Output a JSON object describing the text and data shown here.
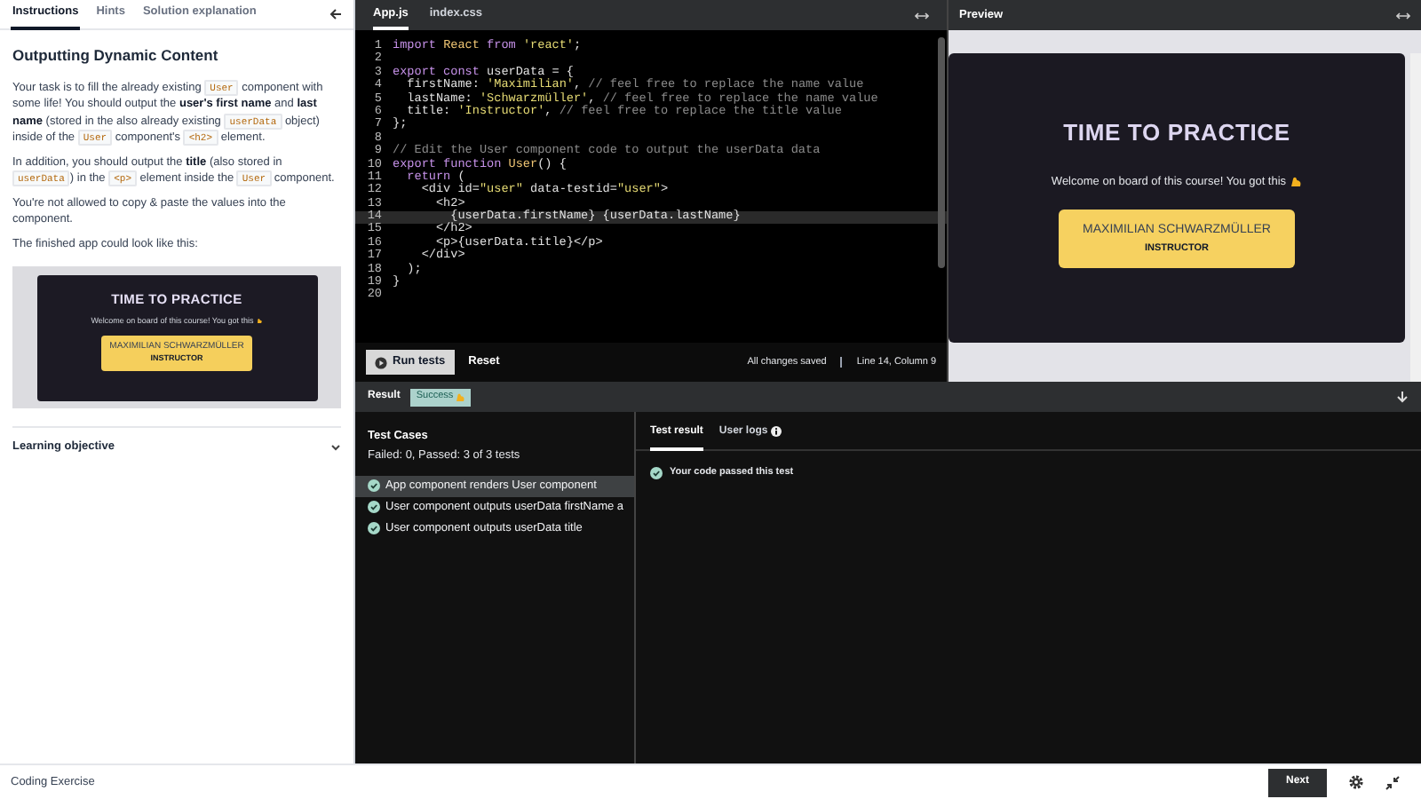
{
  "instructions": {
    "tabs": [
      {
        "label": "Instructions",
        "selected": true
      },
      {
        "label": "Hints",
        "selected": false
      },
      {
        "label": "Solution explanation",
        "selected": false
      }
    ],
    "heading": "Outputting Dynamic Content",
    "paragraphs": [
      [
        {
          "kind": "text",
          "text": "Your task is to fill the already existing "
        },
        {
          "kind": "code",
          "text": "User"
        },
        {
          "kind": "text",
          "text": " component with some life! You should output the "
        },
        {
          "kind": "bold",
          "text": "user's first name"
        },
        {
          "kind": "text",
          "text": " and "
        },
        {
          "kind": "bold",
          "text": "last name"
        },
        {
          "kind": "text",
          "text": " (stored in the also already existing "
        },
        {
          "kind": "code",
          "text": "userData"
        },
        {
          "kind": "text",
          "text": " object) inside of the "
        },
        {
          "kind": "code",
          "text": "User"
        },
        {
          "kind": "text",
          "text": " component's "
        },
        {
          "kind": "code",
          "text": "<h2>"
        },
        {
          "kind": "text",
          "text": " element."
        }
      ],
      [
        {
          "kind": "text",
          "text": "In addition, you should output the "
        },
        {
          "kind": "bold",
          "text": "title"
        },
        {
          "kind": "text",
          "text": " (also stored in "
        },
        {
          "kind": "code",
          "text": "userData"
        },
        {
          "kind": "text",
          "text": ") in the "
        },
        {
          "kind": "code",
          "text": "<p>"
        },
        {
          "kind": "text",
          "text": " element inside the "
        },
        {
          "kind": "code",
          "text": "User"
        },
        {
          "kind": "text",
          "text": " component."
        }
      ],
      [
        {
          "kind": "text",
          "text": "You're not allowed to copy & paste the values into the component."
        }
      ],
      [
        {
          "kind": "text",
          "text": "The finished app could look like this:"
        }
      ]
    ],
    "example": {
      "title": "TIME TO PRACTICE",
      "welcome": "Welcome on board of this course! You got this",
      "name": "MAXIMILIAN SCHWARZMÜLLER",
      "role": "INSTRUCTOR"
    },
    "learning_objective": {
      "label": "Learning objective",
      "expanded": false
    }
  },
  "editor": {
    "tabs": [
      {
        "label": "App.js",
        "selected": true
      },
      {
        "label": "index.css",
        "selected": false
      }
    ],
    "lines": [
      {
        "number": "1",
        "current": false,
        "tokens": [
          {
            "kind": "kw",
            "text": "import "
          },
          {
            "kind": "name",
            "text": "React "
          },
          {
            "kind": "kw",
            "text": "from "
          },
          {
            "kind": "str",
            "text": "'react'"
          },
          {
            "kind": "plain",
            "text": ";"
          }
        ]
      },
      {
        "number": "2",
        "current": false
      },
      {
        "number": "3",
        "current": false,
        "tokens": [
          {
            "kind": "kw",
            "text": "export const"
          },
          {
            "kind": "plain",
            "text": " userData = {"
          }
        ]
      },
      {
        "number": "4",
        "current": false,
        "tokens": [
          {
            "kind": "plain",
            "text": "  firstName: "
          },
          {
            "kind": "str",
            "text": "'Maximilian'"
          },
          {
            "kind": "plain",
            "text": ", "
          },
          {
            "kind": "com",
            "text": "// feel free to replace the name value"
          }
        ]
      },
      {
        "number": "5",
        "current": false,
        "tokens": [
          {
            "kind": "plain",
            "text": "  lastName: "
          },
          {
            "kind": "str",
            "text": "'Schwarzmüller'"
          },
          {
            "kind": "plain",
            "text": ", "
          },
          {
            "kind": "com",
            "text": "// feel free to replace the name value"
          }
        ]
      },
      {
        "number": "6",
        "current": false,
        "tokens": [
          {
            "kind": "plain",
            "text": "  title: "
          },
          {
            "kind": "str",
            "text": "'Instructor'"
          },
          {
            "kind": "plain",
            "text": ", "
          },
          {
            "kind": "com",
            "text": "// feel free to replace the title value"
          }
        ]
      },
      {
        "number": "7",
        "current": false,
        "tokens": [
          {
            "kind": "plain",
            "text": "};"
          }
        ]
      },
      {
        "number": "8",
        "current": false
      },
      {
        "number": "9",
        "current": false,
        "tokens": [
          {
            "kind": "com",
            "text": "// Edit the User component code to output the userData data"
          }
        ]
      },
      {
        "number": "10",
        "current": false,
        "tokens": [
          {
            "kind": "kw",
            "text": "export function "
          },
          {
            "kind": "name",
            "text": "User"
          },
          {
            "kind": "plain",
            "text": "() {"
          }
        ]
      },
      {
        "number": "11",
        "current": false,
        "tokens": [
          {
            "kind": "kw",
            "text": "  return"
          },
          {
            "kind": "plain",
            "text": " ("
          }
        ]
      },
      {
        "number": "12",
        "current": false,
        "tokens": [
          {
            "kind": "plain",
            "text": "    <div id="
          },
          {
            "kind": "str",
            "text": "\"user\""
          },
          {
            "kind": "plain",
            "text": " data-testid="
          },
          {
            "kind": "str",
            "text": "\"user\""
          },
          {
            "kind": "plain",
            "text": ">"
          }
        ]
      },
      {
        "number": "13",
        "current": false,
        "tokens": [
          {
            "kind": "plain",
            "text": "      <h2>"
          }
        ]
      },
      {
        "number": "14",
        "current": true,
        "tokens": [
          {
            "kind": "plain",
            "text": "        {userData.firstName} {userData.lastName}"
          }
        ]
      },
      {
        "number": "15",
        "current": false,
        "tokens": [
          {
            "kind": "plain",
            "text": "      </h2>"
          }
        ]
      },
      {
        "number": "16",
        "current": false,
        "tokens": [
          {
            "kind": "plain",
            "text": "      <p>{userData.title}</p>"
          }
        ]
      },
      {
        "number": "17",
        "current": false,
        "tokens": [
          {
            "kind": "plain",
            "text": "    </div>"
          }
        ]
      },
      {
        "number": "18",
        "current": false,
        "tokens": [
          {
            "kind": "plain",
            "text": "  );"
          }
        ]
      },
      {
        "number": "19",
        "current": false,
        "tokens": [
          {
            "kind": "plain",
            "text": "}"
          }
        ]
      },
      {
        "number": "20",
        "current": false
      }
    ],
    "run_label": "Run tests",
    "reset_label": "Reset",
    "save_status": "All changes saved",
    "cursor": "Line 14, Column 9"
  },
  "preview": {
    "title": "Preview",
    "app_title": "TIME TO PRACTICE",
    "welcome": "Welcome on board of this course! You got this",
    "name": "MAXIMILIAN SCHWARZMÜLLER",
    "role": "INSTRUCTOR"
  },
  "result": {
    "label": "Result",
    "badge": "Success",
    "test_cases_title": "Test Cases",
    "summary": "Failed: 0, Passed: 3 of 3 tests",
    "tests": [
      {
        "label": "App component renders User component",
        "passed": true,
        "selected": true
      },
      {
        "label": "User component outputs userData firstName a",
        "passed": true,
        "selected": false
      },
      {
        "label": "User component outputs userData title",
        "passed": true,
        "selected": false
      }
    ],
    "tabs": [
      {
        "label": "Test result",
        "selected": true
      },
      {
        "label": "User logs",
        "selected": false
      }
    ],
    "message": "Your code passed this test"
  },
  "footer": {
    "label": "Coding Exercise",
    "next": "Next"
  }
}
